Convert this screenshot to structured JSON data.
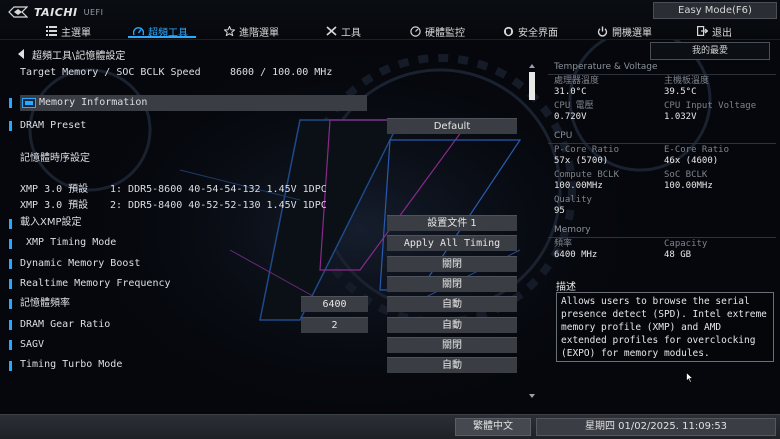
{
  "app": {
    "brand": "TAICHI",
    "sub": "UEFI",
    "mode_button": "Easy Mode(F6)"
  },
  "nav": [
    {
      "label": "主選單",
      "icon": "menu-list-icon"
    },
    {
      "label": "超頻工具",
      "icon": "speedometer-icon",
      "active": true
    },
    {
      "label": "進階選單",
      "icon": "star-icon"
    },
    {
      "label": "工具",
      "icon": "tools-icon"
    },
    {
      "label": "硬體監控",
      "icon": "monitor-gauge-icon"
    },
    {
      "label": "安全界面",
      "icon": "shield-icon"
    },
    {
      "label": "開機選單",
      "icon": "power-icon"
    },
    {
      "label": "退出",
      "icon": "exit-icon"
    }
  ],
  "breadcrumb": "超頻工具\\記憶體設定",
  "favorites": "我的最愛",
  "target_memory": {
    "label": "Target Memory / SOC BCLK Speed",
    "value": "8600 / 100.00 MHz"
  },
  "settings": {
    "memory_information": "Memory Information",
    "dram_preset": {
      "label": "DRAM Preset",
      "value": "Default"
    },
    "timing_section": "記憶體時序設定",
    "xmp1": {
      "label": "XMP 3.0 預設",
      "value": "1: DDR5-8600 40-54-54-132 1.45V 1DPC"
    },
    "xmp2": {
      "label": "XMP 3.0 預設",
      "value": "2: DDR5-8400 40-52-52-130 1.45V 1DPC"
    },
    "load_xmp": {
      "label": "載入XMP設定",
      "value": "設置文件 1"
    },
    "xmp_timing_mode": {
      "label": "XMP Timing Mode",
      "value": "Apply All Timing"
    },
    "dynamic_memory_boost": {
      "label": "Dynamic Memory Boost",
      "value": "關閉"
    },
    "realtime_memory_frequency": {
      "label": "Realtime Memory Frequency",
      "value": "關閉"
    },
    "memory_frequency": {
      "label": "記憶體頻率",
      "input": "6400",
      "value": "自動"
    },
    "dram_gear_ratio": {
      "label": "DRAM Gear Ratio",
      "input": "2",
      "value": "自動"
    },
    "sagv": {
      "label": "SAGV",
      "value": "關閉"
    },
    "timing_turbo_mode": {
      "label": "Timing Turbo Mode",
      "value": "自動"
    }
  },
  "panel": {
    "temp_header": "Temperature & Voltage",
    "cpu_temp": {
      "label": "處理器溫度",
      "value": "31.0°C"
    },
    "mb_temp": {
      "label": "主機板溫度",
      "value": "39.5°C"
    },
    "cpu_voltage": {
      "label": "CPU 電壓",
      "value": "0.720V"
    },
    "cpu_input_voltage": {
      "label": "CPU Input Voltage",
      "value": "1.032V"
    },
    "cpu_header": "CPU",
    "pcore_ratio": {
      "label": "P-Core Ratio",
      "value": "57x (5700)"
    },
    "ecore_ratio": {
      "label": "E-Core Ratio",
      "value": "46x (4600)"
    },
    "compute_bclk": {
      "label": "Compute BCLK",
      "value": "100.00MHz"
    },
    "soc_bclk": {
      "label": "SoC BCLK",
      "value": "100.00MHz"
    },
    "quality": {
      "label": "Quality",
      "value": "95"
    },
    "memory_header": "Memory",
    "frequency": {
      "label": "頻率",
      "value": "6400 MHz"
    },
    "capacity": {
      "label": "Capacity",
      "value": "48 GB"
    },
    "desc_title": "描述",
    "description": "Allows users to browse the serial presence detect (SPD). Intel extreme memory profile (XMP) and AMD extended profiles for overclocking (EXPO) for memory modules."
  },
  "footer": {
    "language": "繁體中文",
    "datetime": "星期四 01/02/2025. 11:09:53"
  },
  "colors": {
    "accent": "#29a8ff",
    "background": "#05070c",
    "value_box": "#3a3d43"
  }
}
